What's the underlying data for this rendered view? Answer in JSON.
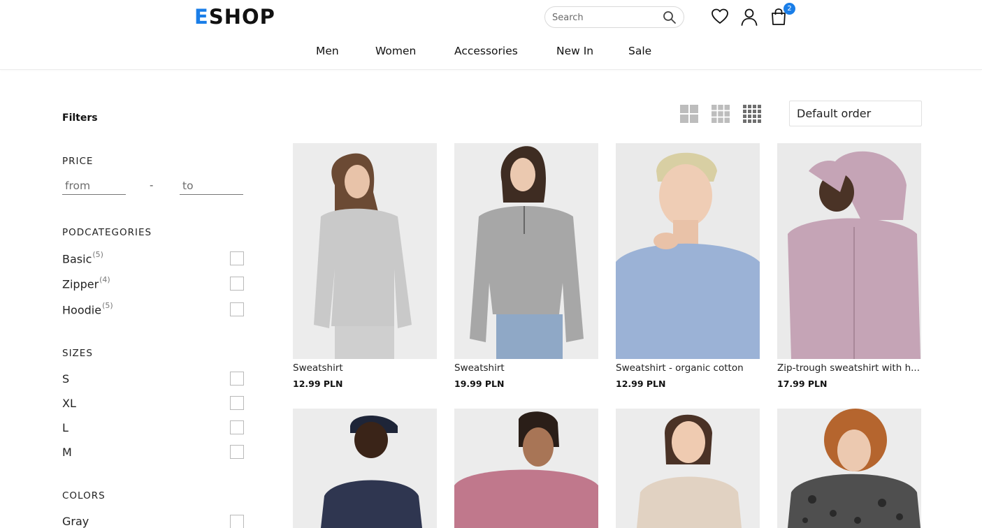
{
  "header": {
    "logo_first": "E",
    "logo_rest": "SHOP",
    "search_placeholder": "Search",
    "cart_count": "2",
    "nav": [
      "Men",
      "Women",
      "Accessories",
      "New In",
      "Sale"
    ],
    "accent_color": "#1a7ee8"
  },
  "sidebar": {
    "title": "Filters",
    "price": {
      "label": "PRICE",
      "from_placeholder": "from",
      "separator": "-",
      "to_placeholder": "to"
    },
    "subcategories": {
      "label": "PODCATEGORIES",
      "items": [
        {
          "name": "Basic",
          "count": "(5)"
        },
        {
          "name": "Zipper",
          "count": "(4)"
        },
        {
          "name": "Hoodie",
          "count": "(5)"
        }
      ]
    },
    "sizes": {
      "label": "SIZES",
      "items": [
        "S",
        "XL",
        "L",
        "M"
      ]
    },
    "colors": {
      "label": "COLORS",
      "items": [
        "Gray"
      ]
    }
  },
  "toolbar": {
    "view_icons": [
      "grid-2-icon",
      "grid-3-icon",
      "grid-4-icon"
    ],
    "sort_value": "Default order"
  },
  "products": [
    {
      "name": "Sweatshirt",
      "price": "12.99 PLN",
      "color": "#c9c9c9"
    },
    {
      "name": "Sweatshirt",
      "price": "19.99 PLN",
      "color": "#a8a8a8"
    },
    {
      "name": "Sweatshirt - organic cotton",
      "price": "12.99 PLN",
      "color": "#9bb2d6"
    },
    {
      "name": "Zip-trough sweatshirt with h...",
      "price": "17.99 PLN",
      "color": "#c5a4b6"
    },
    {
      "name": "",
      "price": "",
      "color": "#2f3650"
    },
    {
      "name": "",
      "price": "",
      "color": "#c0788c"
    },
    {
      "name": "",
      "price": "",
      "color": "#e1d2c2"
    },
    {
      "name": "",
      "price": "",
      "color": "#4f4f4f"
    }
  ]
}
